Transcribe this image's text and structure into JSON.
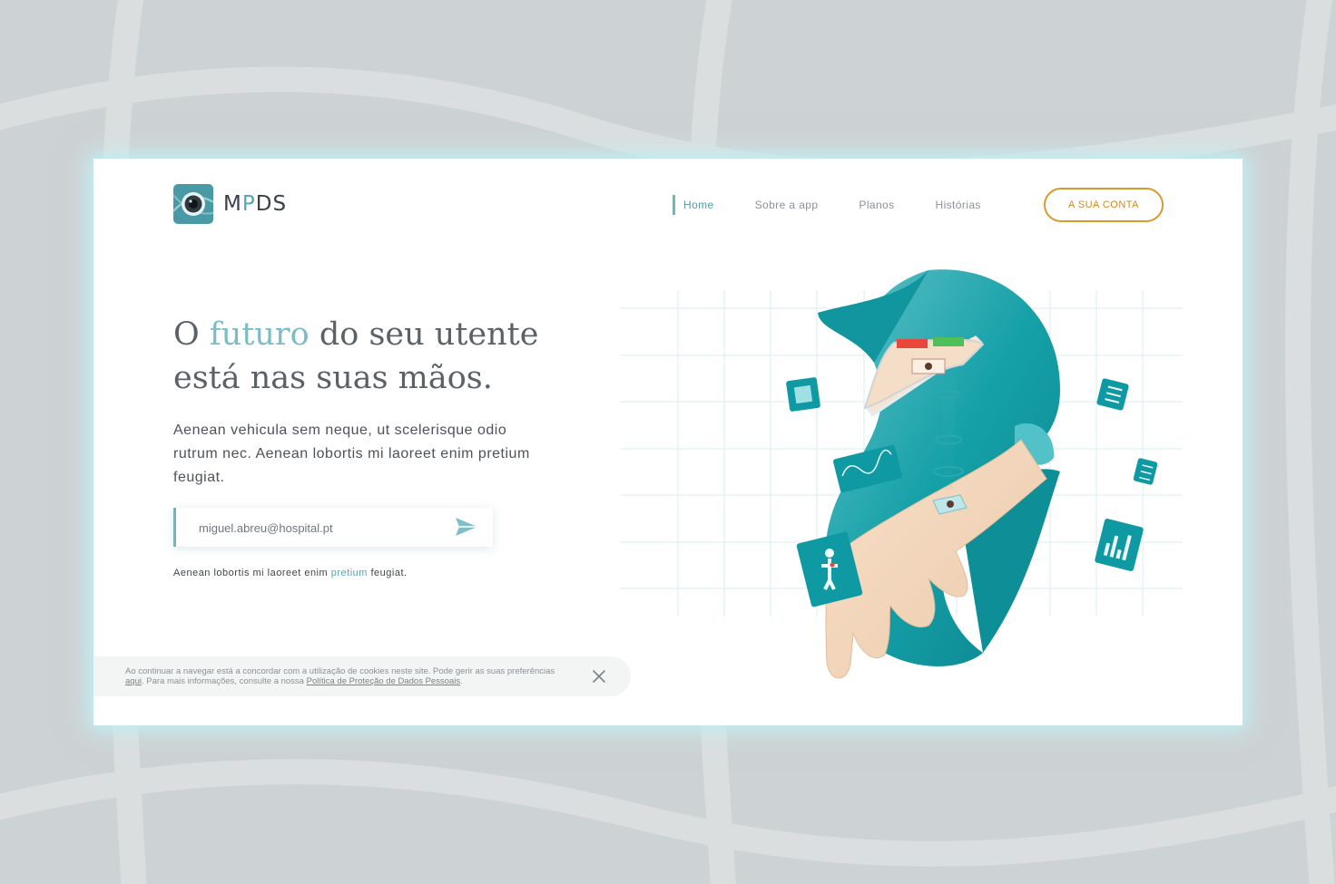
{
  "brand": {
    "logo_prefix": "M",
    "logo_accent": "P",
    "logo_suffix": "DS"
  },
  "nav": {
    "items": [
      {
        "label": "Home",
        "active": true
      },
      {
        "label": "Sobre a app",
        "active": false
      },
      {
        "label": "Planos",
        "active": false
      },
      {
        "label": "Histórias",
        "active": false
      }
    ],
    "account_button": "A SUA CONTA"
  },
  "hero": {
    "headline_pre": "O ",
    "headline_highlight": "futuro",
    "headline_post": " do seu utente",
    "headline_line2": "está nas suas mãos.",
    "subtext": "Aenean vehicula sem neque, ut scelerisque odio rutrum nec. Aenean lobortis mi laoreet enim pretium feugiat.",
    "email_value": "miguel.abreu@hospital.pt",
    "note_pre": "Aenean lobortis mi laoreet enim ",
    "note_link": "pretium",
    "note_post": " feugiat."
  },
  "cookie": {
    "text_1": "Ao continuar a navegar está a concordar com a utilização de cookies neste site. Pode gerir as suas preferências ",
    "link_1": "aqui",
    "text_2": ". Para mais informações, consulte a nossa ",
    "link_2": "Política de Proteção de Dados Pessoais",
    "text_3": "."
  },
  "icons": {
    "logo": "camera-lens-icon",
    "send": "send-icon",
    "close": "close-icon",
    "floating": [
      "xray-icon",
      "ecg-icon",
      "body-scan-icon",
      "checklist-icon",
      "sliders-icon",
      "bar-chart-icon"
    ]
  },
  "colors": {
    "accent": "#4da9b4",
    "teal_dark": "#0f9aa3",
    "cta": "#d99a2b",
    "background": "#cdd2d4"
  }
}
